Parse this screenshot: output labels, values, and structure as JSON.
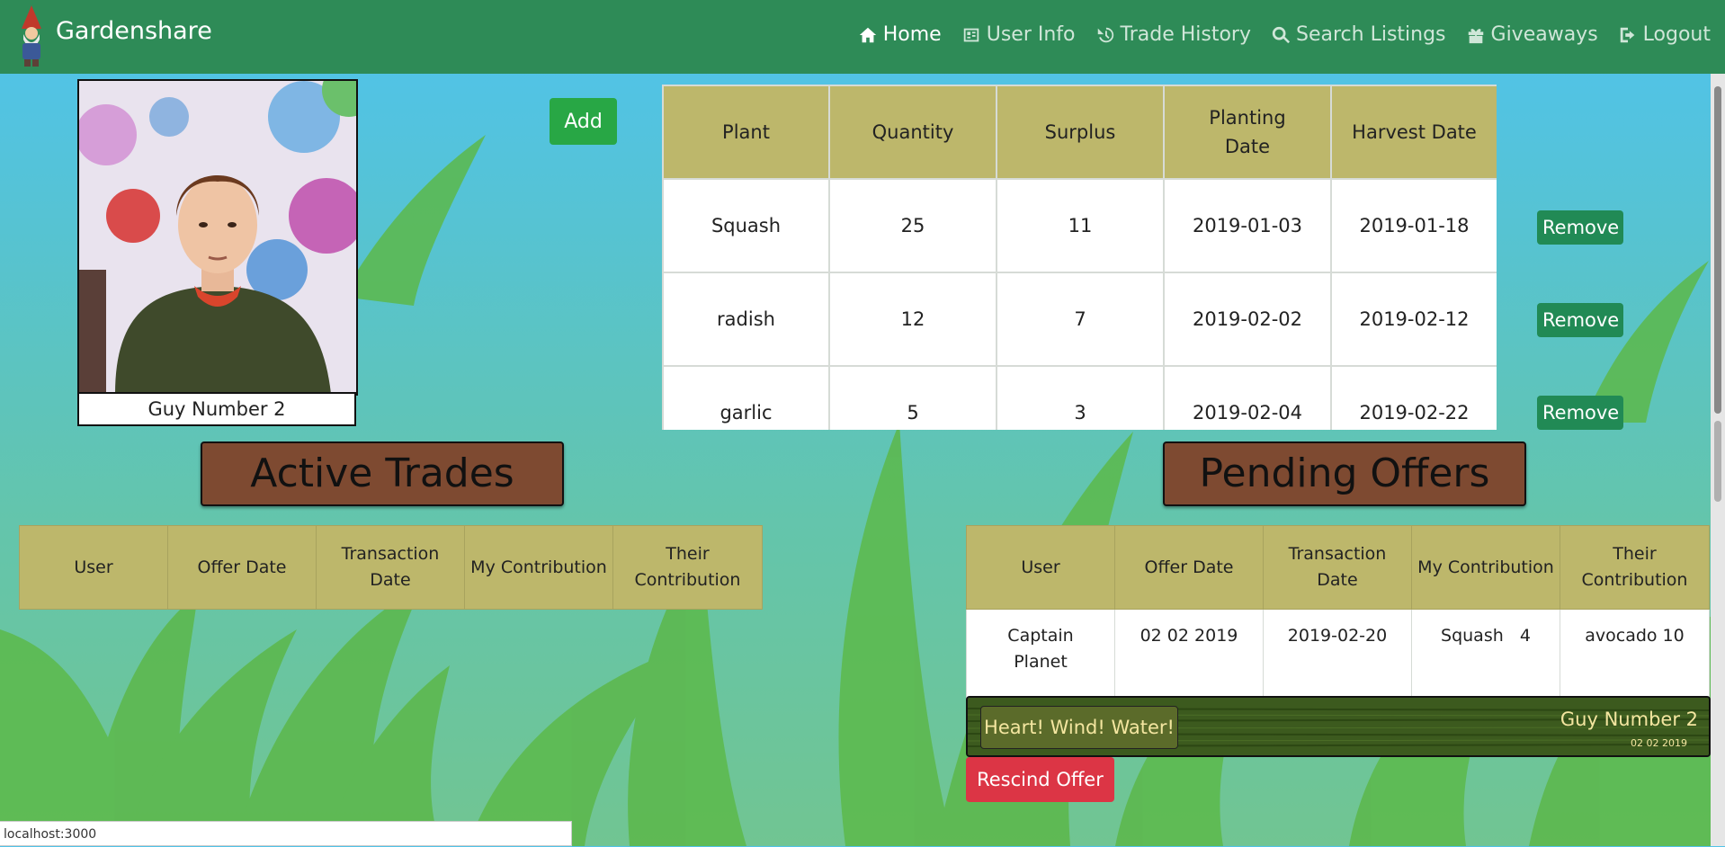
{
  "app": {
    "brand": "Gardenshare"
  },
  "nav": [
    {
      "label": "Home",
      "icon": "home-icon",
      "active": true
    },
    {
      "label": "User Info",
      "icon": "id-card-icon"
    },
    {
      "label": "Trade History",
      "icon": "history-icon"
    },
    {
      "label": "Search Listings",
      "icon": "search-icon"
    },
    {
      "label": "Giveaways",
      "icon": "gift-icon"
    },
    {
      "label": "Logout",
      "icon": "logout-icon"
    }
  ],
  "profile": {
    "name": "Guy Number 2"
  },
  "buttons": {
    "add": "Add",
    "remove": "Remove",
    "rescind": "Rescind Offer"
  },
  "plants": {
    "headers": [
      "Plant",
      "Quantity",
      "Surplus",
      "Planting Date",
      "Harvest Date"
    ],
    "rows": [
      [
        "Squash",
        "25",
        "11",
        "2019-01-03",
        "2019-01-18"
      ],
      [
        "radish",
        "12",
        "7",
        "2019-02-02",
        "2019-02-12"
      ],
      [
        "garlic",
        "5",
        "3",
        "2019-02-04",
        "2019-02-22"
      ]
    ]
  },
  "active_trades": {
    "title": "Active Trades",
    "headers": [
      "User",
      "Offer Date",
      "Transaction Date",
      "My Contribution",
      "Their Contribution"
    ]
  },
  "pending_offers": {
    "title": "Pending Offers",
    "headers": [
      "User",
      "Offer Date",
      "Transaction Date",
      "My Contribution",
      "Their Contribution"
    ],
    "rows": [
      [
        "Captain Planet",
        "02 02 2019",
        "2019-02-20",
        "Squash   4",
        "avocado 10"
      ]
    ],
    "message": {
      "text": "Heart! Wind! Water!",
      "user": "Guy Number 2",
      "date": "02 02 2019"
    }
  },
  "status_bar": "localhost:3000",
  "colors": {
    "navbar": "#2e8b57",
    "table_header": "#bdb76b",
    "heading": "#7e4a31",
    "add": "#28a745",
    "remove": "#218a55",
    "rescind": "#dc3545"
  }
}
